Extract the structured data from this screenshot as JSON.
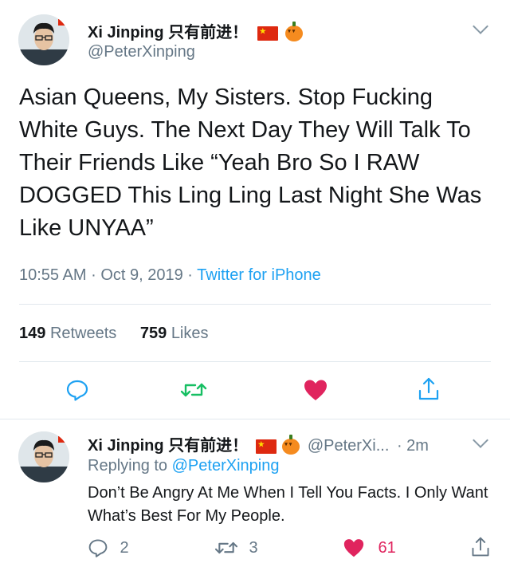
{
  "main_tweet": {
    "display_name": "Xi Jinping 只有前进！",
    "handle": "@PeterXinping",
    "text": "Asian Queens, My Sisters. Stop Fucking White Guys. The Next Day They Will Talk To Their Friends Like “Yeah Bro So I RAW DOGGED This Ling Ling Last Night She Was Like UNYAA”",
    "time": "10:55 AM",
    "dot1": "·",
    "date": "Oct 9, 2019",
    "dot2": "·",
    "source": "Twitter for iPhone",
    "retweets_count": "149",
    "retweets_label": "Retweets",
    "likes_count": "759",
    "likes_label": "Likes"
  },
  "reply_tweet": {
    "display_name": "Xi Jinping 只有前进！",
    "handle": "@PeterXi...",
    "age": "· 2m",
    "replying_prefix": "Replying to",
    "replying_handle": "@PeterXinping",
    "text": "Don’t Be Angry At Me When I Tell You Facts. I Only Want What’s Best For My People.",
    "reply_count": "2",
    "retweet_count": "3",
    "like_count": "61"
  },
  "colors": {
    "accent": "#1da1f2",
    "retweet_green": "#17bf63",
    "like_red": "#e0245e",
    "muted": "#657786"
  },
  "icons": [
    "chevron-down-icon",
    "china-flag-icon",
    "pumpkin-icon",
    "reply-icon",
    "retweet-icon",
    "like-icon",
    "share-icon"
  ]
}
